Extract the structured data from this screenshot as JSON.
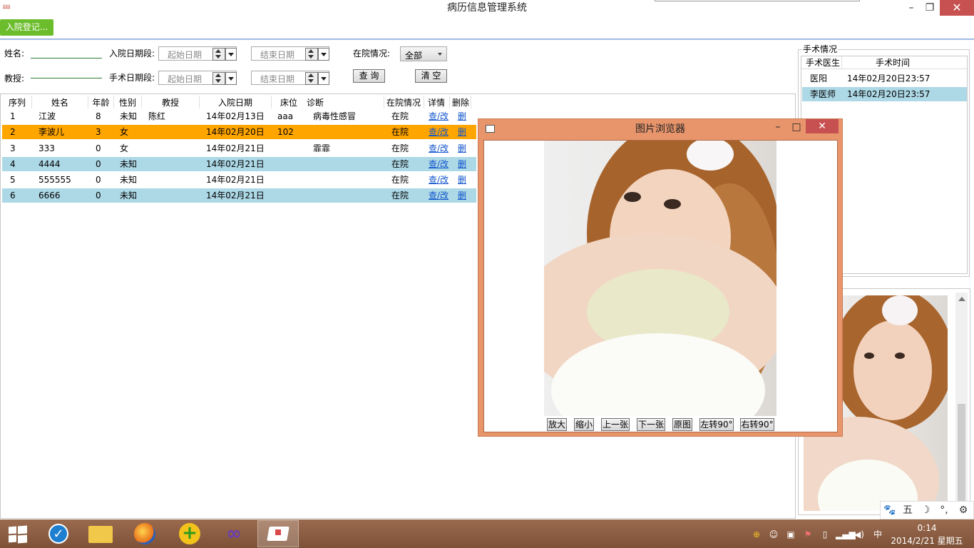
{
  "window": {
    "title": "病历信息管理系统",
    "minimize": "–",
    "maximize": "❐",
    "close": "✕",
    "app_icon": "⅏"
  },
  "toolbar": {
    "admit_button": "入院登记..."
  },
  "search": {
    "name_label": "姓名:",
    "professor_label": "教授:",
    "admit_date_label": "入院日期段:",
    "surgery_date_label": "手术日期段:",
    "start_date_placeholder": "起始日期",
    "end_date_placeholder": "结束日期",
    "status_label": "在院情况:",
    "status_value": "全部",
    "query_button": "查 询",
    "clear_button": "清 空"
  },
  "table": {
    "headers": [
      "序列",
      "姓名",
      "年龄",
      "性别",
      "教授",
      "入院日期",
      "床位",
      "诊断",
      "在院情况",
      "详情",
      "删除"
    ],
    "rows": [
      {
        "seq": "1",
        "name": "江波",
        "age": "8",
        "sex": "未知",
        "prof": "陈红",
        "date": "14年02月13日",
        "bed": "aaa",
        "diag": "病毒性感冒",
        "status": "在院",
        "detail": "查/改",
        "del": "删"
      },
      {
        "seq": "2",
        "name": "李波儿",
        "age": "3",
        "sex": "女",
        "prof": "",
        "date": "14年02月20日",
        "bed": "102",
        "diag": "",
        "status": "在院",
        "detail": "查/改",
        "del": "删"
      },
      {
        "seq": "3",
        "name": "333",
        "age": "0",
        "sex": "女",
        "prof": "",
        "date": "14年02月21日",
        "bed": "",
        "diag": "霏霏",
        "status": "在院",
        "detail": "查/改",
        "del": "删"
      },
      {
        "seq": "4",
        "name": "4444",
        "age": "0",
        "sex": "未知",
        "prof": "",
        "date": "14年02月21日",
        "bed": "",
        "diag": "",
        "status": "在院",
        "detail": "查/改",
        "del": "删"
      },
      {
        "seq": "5",
        "name": "555555",
        "age": "0",
        "sex": "未知",
        "prof": "",
        "date": "14年02月21日",
        "bed": "",
        "diag": "",
        "status": "在院",
        "detail": "查/改",
        "del": "删"
      },
      {
        "seq": "6",
        "name": "6666",
        "age": "0",
        "sex": "未知",
        "prof": "",
        "date": "14年02月21日",
        "bed": "",
        "diag": "",
        "status": "在院",
        "detail": "查/改",
        "del": "删"
      }
    ]
  },
  "surgery": {
    "group_title": "手术情况",
    "headers": [
      "手术医生",
      "手术时间"
    ],
    "rows": [
      {
        "doctor": "医阳",
        "time": "14年02月20日23:57"
      },
      {
        "doctor": "李医师",
        "time": "14年02月20日23:57"
      }
    ]
  },
  "viewer": {
    "title": "图片浏览器",
    "minimize": "–",
    "maximize": "□",
    "close": "✕",
    "buttons": [
      "放大",
      "缩小",
      "上一张",
      "下一张",
      "原图",
      "左转90°",
      "右转90°"
    ]
  },
  "ime": [
    "🐾",
    "五",
    "☽",
    "°,",
    "⚙"
  ],
  "taskbar": {
    "time": "0:14",
    "date": "2014/2/21 星期五",
    "lang": "中"
  },
  "colors": {
    "accent_green": "#6cbd2c",
    "selected_row": "#ffa500",
    "alt_row": "#add8e6",
    "viewer_frame": "#e8956c",
    "close_red": "#c75050",
    "taskbar": "#8a5c42"
  }
}
